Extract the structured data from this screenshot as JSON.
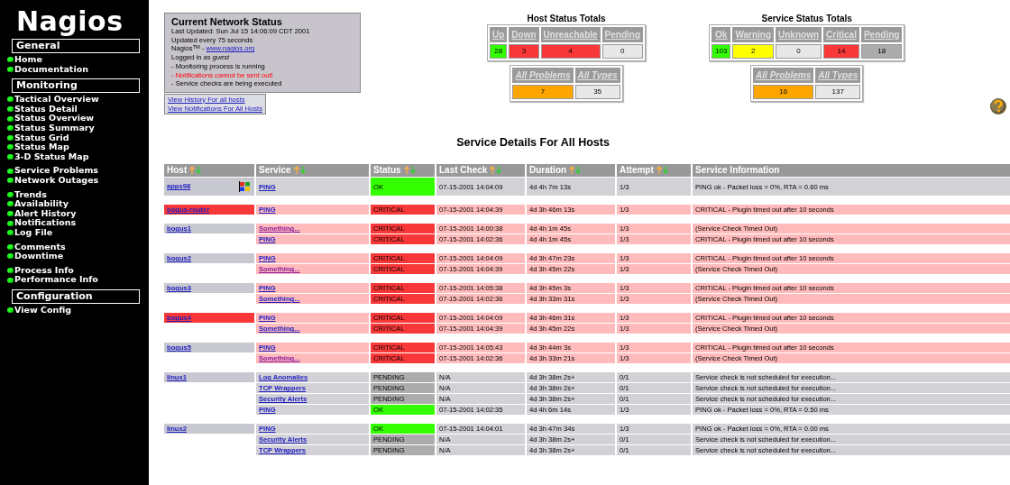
{
  "sidebar": {
    "logo": "Nagios",
    "sections": [
      {
        "title": "General",
        "groups": [
          [
            "Home",
            "Documentation"
          ]
        ]
      },
      {
        "title": "Monitoring",
        "groups": [
          [
            "Tactical Overview",
            "Status Detail",
            "Status Overview",
            "Status Summary",
            "Status Grid",
            "Status Map",
            "3-D Status Map"
          ],
          [
            "Service Problems",
            "Network Outages"
          ],
          [
            "Trends",
            "Availability",
            "Alert History",
            "Notifications",
            "Log File"
          ],
          [
            "Comments",
            "Downtime"
          ],
          [
            "Process Info",
            "Performance Info"
          ]
        ]
      },
      {
        "title": "Configuration",
        "groups": [
          [
            "View Config"
          ]
        ]
      }
    ]
  },
  "status_box": {
    "title": "Current Network Status",
    "lines": [
      {
        "kind": "plain",
        "text": "Last Updated: Sun Jul 15 14:06:09 CDT 2001"
      },
      {
        "kind": "plain",
        "text": "Updated every 75 seconds"
      },
      {
        "kind": "link",
        "text": "Nagios$^{TM}$ - ",
        "link": "www.nagios.org"
      },
      {
        "kind": "plain",
        "text": "Logged in *as guest*"
      },
      {
        "kind": "plain",
        "text": "- Monitoring process is running"
      },
      {
        "kind": "alert",
        "text": "- Notifications cannot be sent out!"
      },
      {
        "kind": "plain",
        "text": "- Service checks are being executed"
      }
    ],
    "links": [
      "View History For all hosts",
      "View Notifications For All Hosts"
    ]
  },
  "host_totals": {
    "title": "Host Status Totals",
    "cells": [
      {
        "label": "Up",
        "value": "28",
        "color": "#33ff00"
      },
      {
        "label": "Down",
        "value": "3",
        "color": "#f83838"
      },
      {
        "label": "Unreachable",
        "value": "4",
        "color": "#f83838"
      },
      {
        "label": "Pending",
        "value": "0",
        "color": "#e8e8e8"
      }
    ],
    "summary": [
      {
        "label": "All Problems",
        "value": "7",
        "color": "#ffa500"
      },
      {
        "label": "All Types",
        "value": "35",
        "color": "#e8e8e8"
      }
    ]
  },
  "service_totals": {
    "title": "Service Status Totals",
    "cells": [
      {
        "label": "Ok",
        "value": "103",
        "color": "#33ff00"
      },
      {
        "label": "Warning",
        "value": "2",
        "color": "#ffff00"
      },
      {
        "label": "Unknown",
        "value": "0",
        "color": "#e8e8e8"
      },
      {
        "label": "Critical",
        "value": "14",
        "color": "#f83838"
      },
      {
        "label": "Pending",
        "value": "18",
        "color": "#acacac"
      }
    ],
    "summary": [
      {
        "label": "All Problems",
        "value": "16",
        "color": "#ffa500"
      },
      {
        "label": "All Types",
        "value": "137",
        "color": "#e8e8e8"
      }
    ]
  },
  "page_title": "Service Details For All Hosts",
  "table": {
    "columns": [
      {
        "label": "Host",
        "sortable": true
      },
      {
        "label": "Service",
        "sortable": true
      },
      {
        "label": "Status",
        "sortable": true
      },
      {
        "label": "Last Check",
        "sortable": true
      },
      {
        "label": "Duration",
        "sortable": true
      },
      {
        "label": "Attempt",
        "sortable": true
      },
      {
        "label": "Service Information",
        "sortable": false
      }
    ],
    "hosts": [
      {
        "name": "apps98",
        "down": false,
        "os_icon": true,
        "services": [
          {
            "service": "PING",
            "visited": false,
            "kind": "ok",
            "status_text": "OK",
            "last_check": "07-15-2001 14:04:09",
            "duration": "4d 4h 7m 13s",
            "attempt": "1/3",
            "info": "PING ok - Packet loss = 0%, RTA = 0.60 ms"
          }
        ]
      },
      {
        "name": "bogus-router",
        "down": true,
        "os_icon": false,
        "services": [
          {
            "service": "PING",
            "visited": false,
            "kind": "critical",
            "status_text": "CRITICAL",
            "last_check": "07-15-2001 14:04:39",
            "duration": "4d 3h 46m 13s",
            "attempt": "1/3",
            "info": "CRITICAL - Plugin timed out after 10 seconds"
          }
        ]
      },
      {
        "name": "bogus1",
        "down": false,
        "os_icon": false,
        "services": [
          {
            "service": "Something...",
            "visited": true,
            "kind": "critical",
            "status_text": "CRITICAL",
            "last_check": "07-15-2001 14:00:38",
            "duration": "4d 4h 1m 45s",
            "attempt": "1/3",
            "info": "(Service Check Timed Out)"
          },
          {
            "service": "PING",
            "visited": false,
            "kind": "critical",
            "status_text": "CRITICAL",
            "last_check": "07-15-2001 14:02:36",
            "duration": "4d 4h 1m 45s",
            "attempt": "1/3",
            "info": "CRITICAL - Plugin timed out after 10 seconds"
          }
        ]
      },
      {
        "name": "bogus2",
        "down": false,
        "os_icon": false,
        "services": [
          {
            "service": "PING",
            "visited": false,
            "kind": "critical",
            "status_text": "CRITICAL",
            "last_check": "07-15-2001 14:04:09",
            "duration": "4d 3h 47m 23s",
            "attempt": "1/3",
            "info": "CRITICAL - Plugin timed out after 10 seconds"
          },
          {
            "service": "Something...",
            "visited": true,
            "kind": "critical",
            "status_text": "CRITICAL",
            "last_check": "07-15-2001 14:04:39",
            "duration": "4d 3h 45m 22s",
            "attempt": "1/3",
            "info": "(Service Check Timed Out)"
          }
        ]
      },
      {
        "name": "bogus3",
        "down": false,
        "os_icon": false,
        "services": [
          {
            "service": "PING",
            "visited": false,
            "kind": "critical",
            "status_text": "CRITICAL",
            "last_check": "07-15-2001 14:05:38",
            "duration": "4d 3h 45m 3s",
            "attempt": "1/3",
            "info": "CRITICAL - Plugin timed out after 10 seconds"
          },
          {
            "service": "Something...",
            "visited": false,
            "kind": "critical",
            "status_text": "CRITICAL",
            "last_check": "07-15-2001 14:02:36",
            "duration": "4d 3h 33m 31s",
            "attempt": "1/3",
            "info": "(Service Check Timed Out)"
          }
        ]
      },
      {
        "name": "bogus4",
        "down": true,
        "os_icon": false,
        "services": [
          {
            "service": "PING",
            "visited": false,
            "kind": "critical",
            "status_text": "CRITICAL",
            "last_check": "07-15-2001 14:04:09",
            "duration": "4d 3h 46m 31s",
            "attempt": "1/3",
            "info": "CRITICAL - Plugin timed out after 10 seconds"
          },
          {
            "service": "Something...",
            "visited": false,
            "kind": "critical",
            "status_text": "CRITICAL",
            "last_check": "07-15-2001 14:04:39",
            "duration": "4d 3h 45m 22s",
            "attempt": "1/3",
            "info": "(Service Check Timed Out)"
          }
        ]
      },
      {
        "name": "bogus5",
        "down": false,
        "os_icon": false,
        "services": [
          {
            "service": "PING",
            "visited": false,
            "kind": "critical",
            "status_text": "CRITICAL",
            "last_check": "07-15-2001 14:05:43",
            "duration": "4d 3h 44m 3s",
            "attempt": "1/3",
            "info": "CRITICAL - Plugin timed out after 10 seconds"
          },
          {
            "service": "Something...",
            "visited": true,
            "kind": "critical",
            "status_text": "CRITICAL",
            "last_check": "07-15-2001 14:02:36",
            "duration": "4d 3h 33m 21s",
            "attempt": "1/3",
            "info": "(Service Check Timed Out)"
          }
        ]
      },
      {
        "name": "linux1",
        "down": false,
        "os_icon": false,
        "services": [
          {
            "service": "Log Anomalies",
            "visited": false,
            "kind": "pending",
            "status_text": "PENDING",
            "last_check": "N/A",
            "duration": "4d 3h 38m 2s+",
            "attempt": "0/1",
            "info": "Service check is not scheduled for execution..."
          },
          {
            "service": "TCP Wrappers",
            "visited": false,
            "kind": "pending",
            "status_text": "PENDING",
            "last_check": "N/A",
            "duration": "4d 3h 38m 2s+",
            "attempt": "0/1",
            "info": "Service check is not scheduled for execution..."
          },
          {
            "service": "Security Alerts",
            "visited": false,
            "kind": "pending",
            "status_text": "PENDING",
            "last_check": "N/A",
            "duration": "4d 3h 38m 2s+",
            "attempt": "0/1",
            "info": "Service check is not scheduled for execution..."
          },
          {
            "service": "PING",
            "visited": false,
            "kind": "ok",
            "status_text": "OK",
            "last_check": "07-15-2001 14:02:35",
            "duration": "4d 4h 6m 14s",
            "attempt": "1/3",
            "info": "PING ok - Packet loss = 0%, RTA = 0.50 ms"
          }
        ]
      },
      {
        "name": "linux2",
        "down": false,
        "os_icon": false,
        "services": [
          {
            "service": "PING",
            "visited": false,
            "kind": "ok",
            "status_text": "OK",
            "last_check": "07-15-2001 14:04:01",
            "duration": "4d 3h 47m 34s",
            "attempt": "1/3",
            "info": "PING ok - Packet loss = 0%, RTA = 0.00 ms"
          },
          {
            "service": "Security Alerts",
            "visited": false,
            "kind": "pending",
            "status_text": "PENDING",
            "last_check": "N/A",
            "duration": "4d 3h 38m 2s+",
            "attempt": "0/1",
            "info": "Service check is not scheduled for execution..."
          },
          {
            "service": "TCP Wrappers",
            "visited": false,
            "kind": "pending",
            "status_text": "PENDING",
            "last_check": "N/A",
            "duration": "4d 3h 38m 2s+",
            "attempt": "0/1",
            "info": "Service check is not scheduled for execution..."
          }
        ]
      }
    ]
  }
}
